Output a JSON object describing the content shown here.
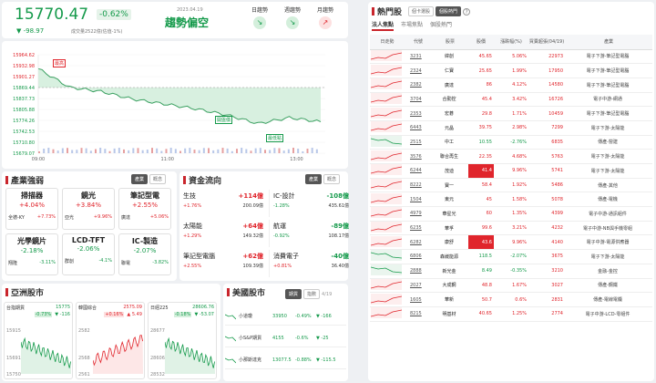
{
  "index": {
    "value": "15770.47",
    "change_pct": "-0.62%",
    "change": "▼ -98.97",
    "date": "2023.04.19",
    "volume": "成交量2522億(估值-1%)",
    "trend": "趨勢偏空"
  },
  "ma_buttons": [
    {
      "label": "日趨勢",
      "color": "#159a4b"
    },
    {
      "label": "週趨勢",
      "color": "#159a4b"
    },
    {
      "label": "月趨勢",
      "color": "#e0252c"
    }
  ],
  "intraday": {
    "y_ticks": [
      "15964.62",
      "15932.98",
      "15901.27",
      "15869.44",
      "15837.73",
      "15805.88",
      "15774.26",
      "15742.53",
      "15710.80",
      "15679.07"
    ],
    "x_ticks": [
      "09:00",
      "11:00",
      "13:00"
    ],
    "labels": {
      "high": "最高",
      "open": "開盤價",
      "low": "最低點"
    }
  },
  "chart_data": {
    "type": "line",
    "title": "",
    "x": [
      "09:00",
      "09:30",
      "10:00",
      "10:30",
      "11:00",
      "11:30",
      "12:00",
      "12:30",
      "13:00",
      "13:30"
    ],
    "series": [
      {
        "values": [
          15924,
          15870,
          15858,
          15836,
          15822,
          15808,
          15790,
          15765,
          15782,
          15770
        ]
      }
    ],
    "ylim": [
      15679.07,
      15964.62
    ]
  },
  "industry": {
    "title": "產業強弱",
    "tabs": [
      "產業",
      "概念"
    ],
    "cards": [
      {
        "name": "掃描器",
        "pct": "+4.04%",
        "sub1": "全德-KY",
        "sub2": "+7.73%"
      },
      {
        "name": "鏡光",
        "pct": "+3.84%",
        "sub1": "亞光",
        "sub2": "+9.96%"
      },
      {
        "name": "筆記型電",
        "pct": "+2.55%",
        "sub1": "廣達",
        "sub2": "+5.06%"
      },
      {
        "name": "光學鏡片",
        "pct": "-2.18%",
        "sub1": "翔隆",
        "sub2": "-3.11%"
      },
      {
        "name": "LCD-TFT",
        "pct": "-2.06%",
        "sub1": "群創",
        "sub2": "-4.1%"
      },
      {
        "name": "IC-製造",
        "pct": "-2.07%",
        "sub1": "聯電",
        "sub2": "-3.82%"
      }
    ]
  },
  "money": {
    "title": "資金流向",
    "tabs": [
      "產業",
      "概念"
    ],
    "items": [
      {
        "name": "生技",
        "pct": "+1.76%",
        "amt": "+114億",
        "total": "200.09億"
      },
      {
        "name": "IC-設計",
        "pct": "-1.28%",
        "amt": "-108億",
        "total": "435.61億"
      },
      {
        "name": "太陽能",
        "pct": "+1.29%",
        "amt": "+64億",
        "total": "149.32億"
      },
      {
        "name": "航運",
        "pct": "-0.92%",
        "amt": "-89億",
        "total": "108.17億"
      },
      {
        "name": "筆記型電腦",
        "pct": "+2.55%",
        "amt": "+62億",
        "total": "109.39億"
      },
      {
        "name": "消費電子",
        "pct": "+0.81%",
        "amt": "-40億",
        "total": "36.40億"
      }
    ]
  },
  "asia": {
    "title": "亞洲股市",
    "boxes": [
      {
        "name": "台指期貨",
        "value": "15775",
        "pct": "-0.73%",
        "chg": "▼ -116",
        "top": "15915",
        "bot": "15750",
        "mid": "15691"
      },
      {
        "name": "韓國綜合",
        "value": "2575.09",
        "pct": "+0.16%",
        "chg": "▲ 5.49",
        "top": "2582",
        "bot": "2561",
        "mid": "2568"
      },
      {
        "name": "日經225",
        "value": "28606.76",
        "pct": "-0.18%",
        "chg": "▼ -53.07",
        "top": "28677",
        "bot": "28532",
        "mid": "28606"
      }
    ]
  },
  "us": {
    "title": "美國股市",
    "tabs": [
      "期貨",
      "指數"
    ],
    "date": "4/19",
    "rows": [
      {
        "name": "小道瓊",
        "value": "33950",
        "pct": "-0.49%",
        "chg": "▼ -166"
      },
      {
        "name": "小S&P期貨",
        "value": "4155",
        "pct": "-0.6%",
        "chg": "▼ -25"
      },
      {
        "name": "小那斯達克",
        "value": "13077.5",
        "pct": "-0.88%",
        "chg": "▼ -115.5"
      }
    ]
  },
  "hot": {
    "title": "熱門股",
    "toggle": [
      "個卡選股",
      "個股熱門"
    ],
    "tabs": [
      "法人焦點",
      "市場焦點",
      "個股熱門"
    ],
    "headers": [
      "日走勢",
      "代號",
      "股票",
      "股價",
      "漲跌幅(%)",
      "買賣超張(04/19)",
      "產業"
    ],
    "rows": [
      {
        "code": "3231",
        "name": "緯創",
        "price": "45.65",
        "pct": "5.06%",
        "vol": "22973",
        "ind": "電子下游-筆記型電腦",
        "up": true
      },
      {
        "code": "2324",
        "name": "仁寶",
        "price": "25.65",
        "pct": "1.99%",
        "vol": "17950",
        "ind": "電子下游-筆記型電腦",
        "up": true
      },
      {
        "code": "2382",
        "name": "廣達",
        "price": "86",
        "pct": "4.12%",
        "vol": "14580",
        "ind": "電子下游-筆記型電腦",
        "up": true
      },
      {
        "code": "3704",
        "name": "合勤控",
        "price": "45.4",
        "pct": "3.42%",
        "vol": "16726",
        "ind": "電子中游-網通",
        "up": true
      },
      {
        "code": "2353",
        "name": "宏碁",
        "price": "29.8",
        "pct": "1.71%",
        "vol": "10459",
        "ind": "電子下游-筆記型電腦",
        "up": true
      },
      {
        "code": "6443",
        "name": "元晶",
        "price": "39.75",
        "pct": "2.98%",
        "vol": "7299",
        "ind": "電子下游-太陽能",
        "up": true
      },
      {
        "code": "2515",
        "name": "中工",
        "price": "10.55",
        "pct": "-2.76%",
        "vol": "6835",
        "ind": "傳產-營建",
        "up": false
      },
      {
        "code": "3576",
        "name": "聯合再生",
        "price": "22.35",
        "pct": "4.68%",
        "vol": "5763",
        "ind": "電子下游-太陽能",
        "up": true
      },
      {
        "code": "6244",
        "name": "茂迪",
        "price": "41.4",
        "pct": "9.96%",
        "vol": "5741",
        "ind": "電子下游-太陽能",
        "up": true,
        "hl": true
      },
      {
        "code": "8222",
        "name": "寶一",
        "price": "58.4",
        "pct": "1.92%",
        "vol": "5486",
        "ind": "傳產-其他",
        "up": true
      },
      {
        "code": "1504",
        "name": "東元",
        "price": "45",
        "pct": "1.58%",
        "vol": "5078",
        "ind": "傳產-電機",
        "up": true
      },
      {
        "code": "4979",
        "name": "華星光",
        "price": "60",
        "pct": "1.35%",
        "vol": "4399",
        "ind": "電子中游-通訊組件",
        "up": true
      },
      {
        "code": "6235",
        "name": "華孚",
        "price": "99.6",
        "pct": "3.21%",
        "vol": "4232",
        "ind": "電子中游-NB與手機零組",
        "up": true
      },
      {
        "code": "6282",
        "name": "康舒",
        "price": "43.6",
        "pct": "9.96%",
        "vol": "4140",
        "ind": "電子中游-電源供應器",
        "up": true,
        "hl": true
      },
      {
        "code": "6806",
        "name": "森崴能源",
        "price": "118.5",
        "pct": "-2.07%",
        "vol": "3675",
        "ind": "電子下游-太陽能",
        "up": false
      },
      {
        "code": "2888",
        "name": "新光金",
        "price": "8.49",
        "pct": "-0.35%",
        "vol": "3210",
        "ind": "金融-金控",
        "up": false
      },
      {
        "code": "2027",
        "name": "大成鋼",
        "price": "48.8",
        "pct": "1.67%",
        "vol": "3027",
        "ind": "傳產-鋼鐵",
        "up": true
      },
      {
        "code": "1605",
        "name": "華新",
        "price": "50.7",
        "pct": "0.6%",
        "vol": "2831",
        "ind": "傳產-電線電纜",
        "up": true
      },
      {
        "code": "8215",
        "name": "明基材",
        "price": "40.65",
        "pct": "1.25%",
        "vol": "2774",
        "ind": "電子中游-LCD-零組件",
        "up": true
      }
    ]
  }
}
